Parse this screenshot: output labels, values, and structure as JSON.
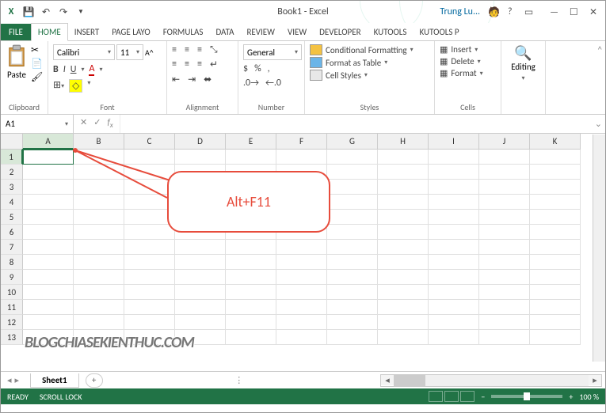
{
  "title": "Book1 - Excel",
  "user": "Trung Lu...",
  "tabs": {
    "file": "FILE",
    "items": [
      "HOME",
      "INSERT",
      "PAGE LAYO",
      "FORMULAS",
      "DATA",
      "REVIEW",
      "VIEW",
      "DEVELOPER",
      "KUTOOLS",
      "KUTOOLS P"
    ],
    "active": 0
  },
  "ribbon": {
    "clipboard": {
      "label": "Clipboard",
      "paste": "Paste"
    },
    "font": {
      "label": "Font",
      "name": "Calibri",
      "size": "11"
    },
    "alignment": {
      "label": "Alignment"
    },
    "number": {
      "label": "Number",
      "format": "General"
    },
    "styles": {
      "label": "Styles",
      "cond": "Conditional Formatting",
      "table": "Format as Table",
      "cell": "Cell Styles"
    },
    "cells": {
      "label": "Cells",
      "insert": "Insert",
      "delete": "Delete",
      "format": "Format"
    },
    "editing": {
      "label": "Editing",
      "text": "Editing"
    }
  },
  "namebox": "A1",
  "columns": [
    "A",
    "B",
    "C",
    "D",
    "E",
    "F",
    "G",
    "H",
    "I",
    "J",
    "K"
  ],
  "rows": [
    "1",
    "2",
    "3",
    "4",
    "5",
    "6",
    "7",
    "8",
    "9",
    "10",
    "11",
    "12",
    "13"
  ],
  "active_cell": "A1",
  "callout": "Alt+F11",
  "sheet": {
    "name": "Sheet1"
  },
  "status": {
    "ready": "READY",
    "scroll": "SCROLL LOCK",
    "zoom": "100 %"
  },
  "watermark": "BLOGCHIASEKIENTHUC.COM"
}
